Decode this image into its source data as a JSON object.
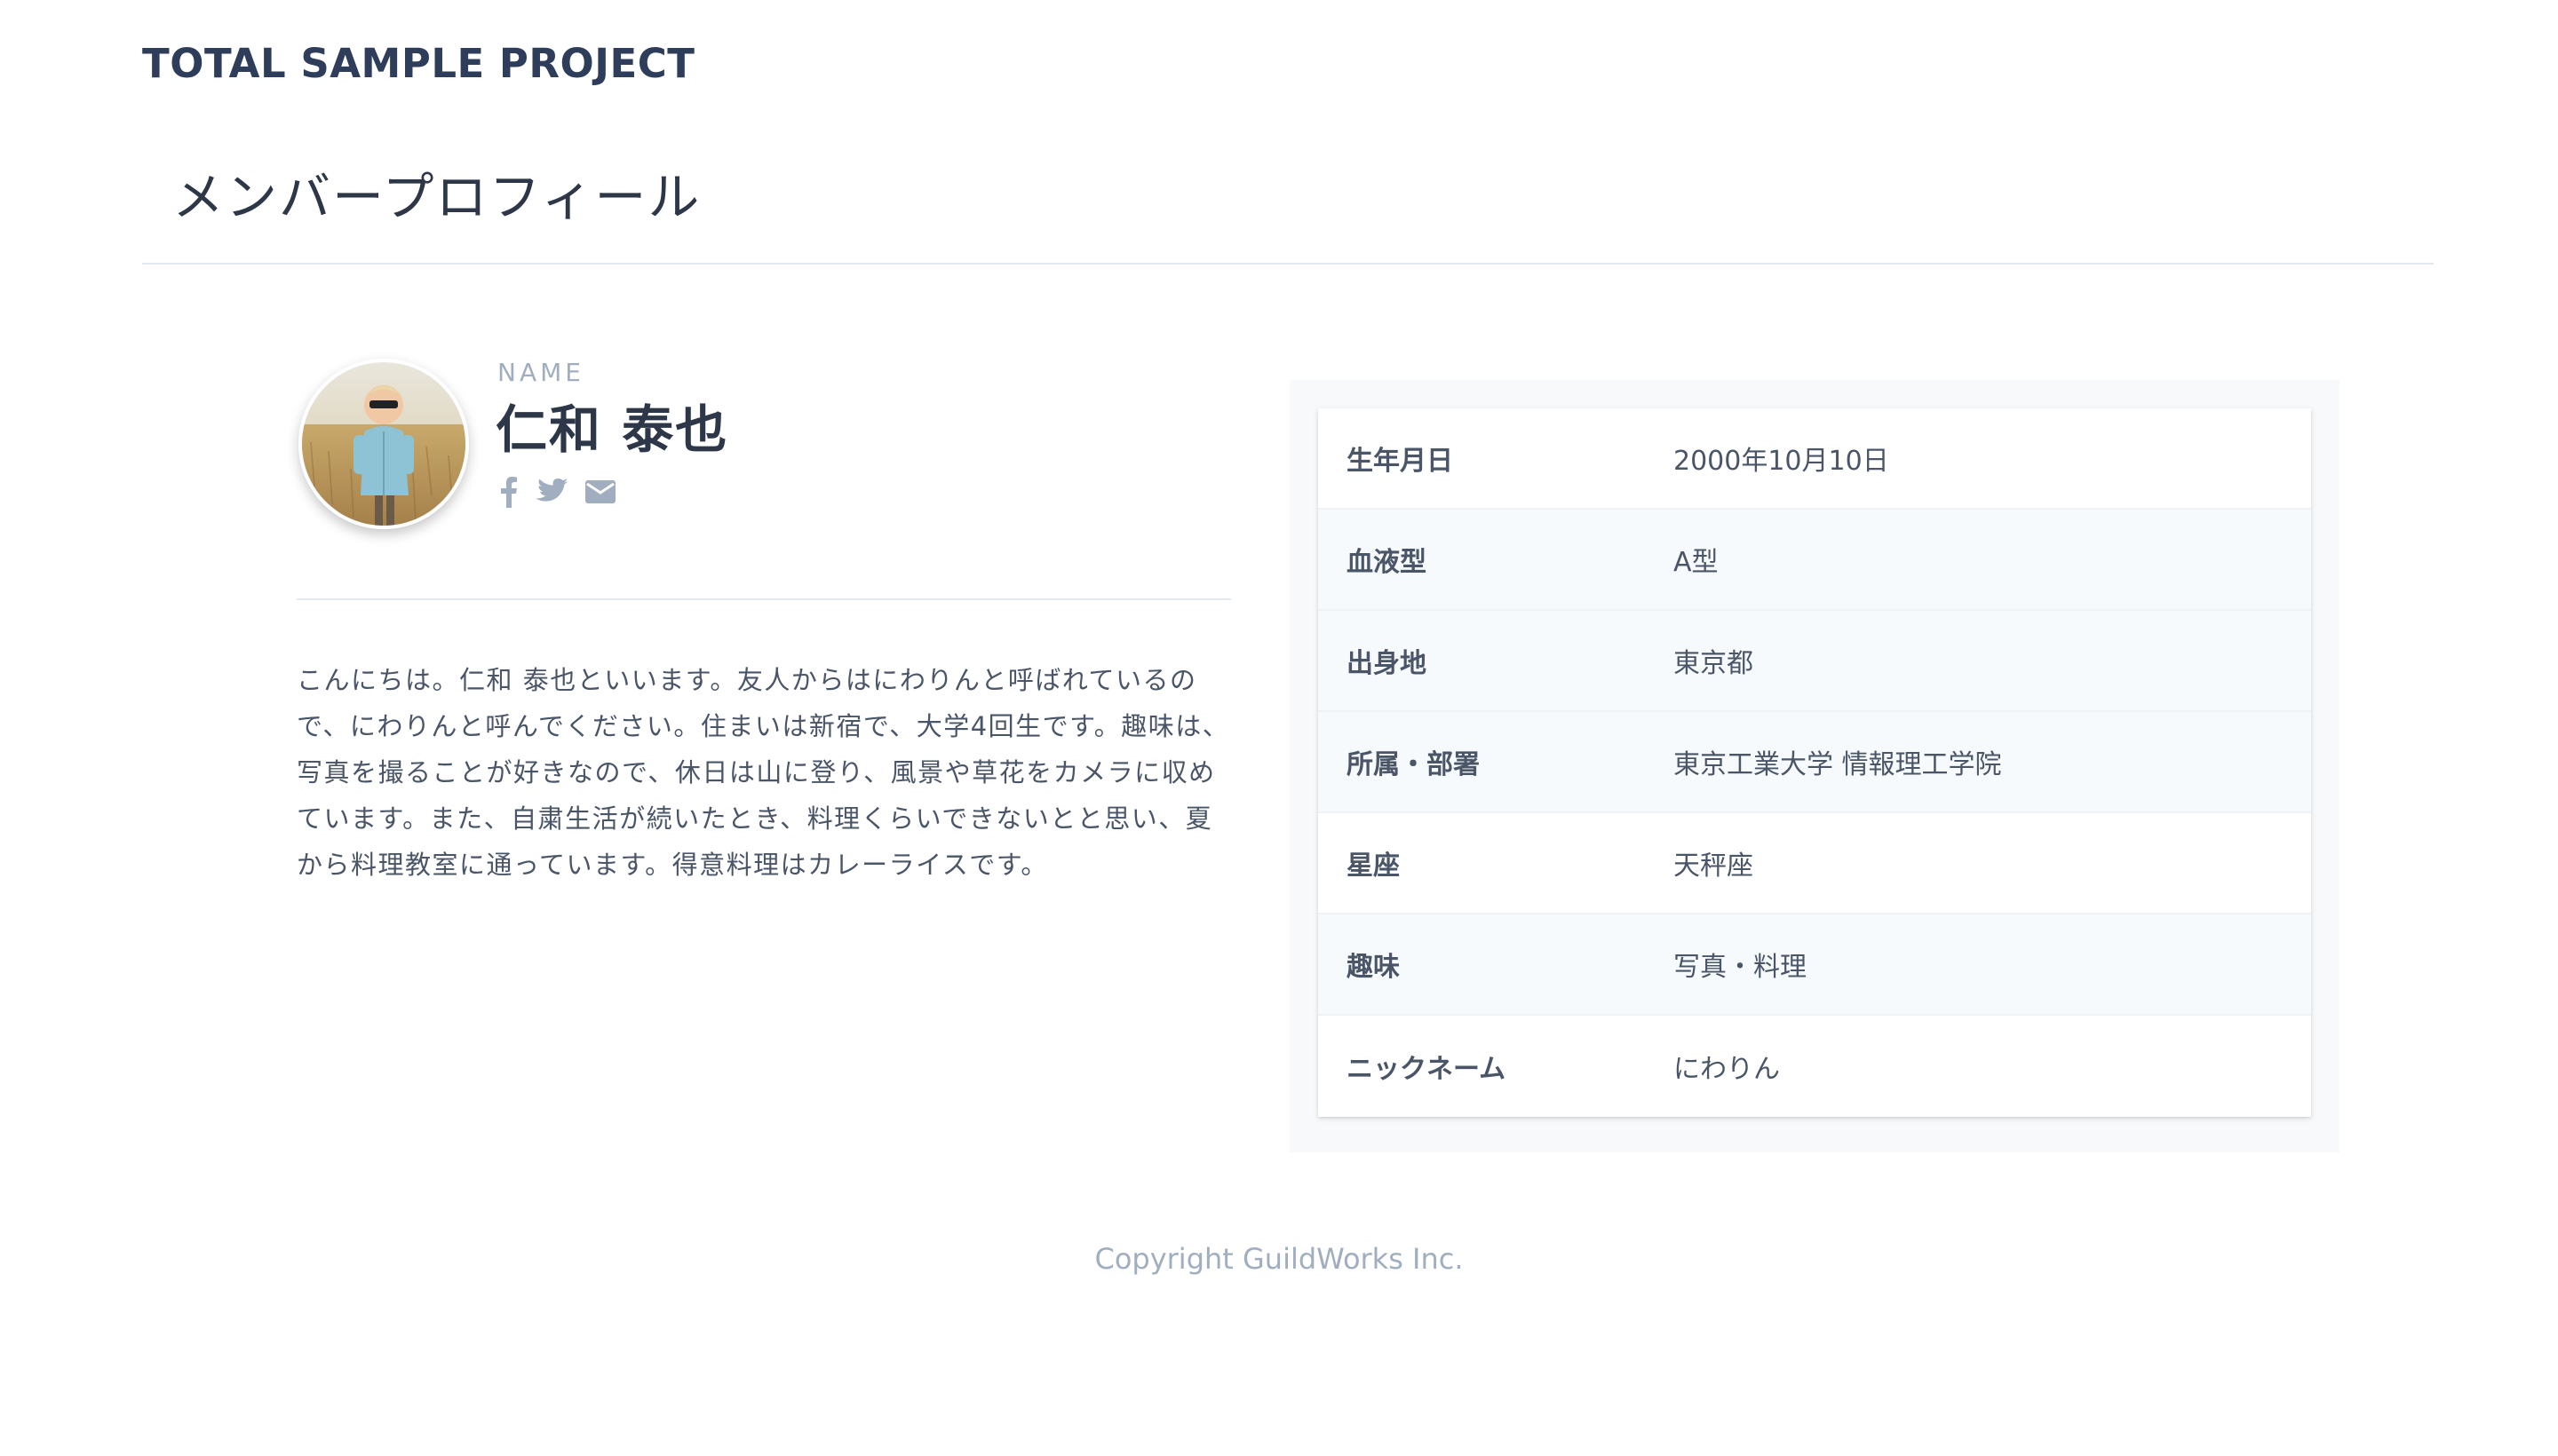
{
  "header": {
    "site_title": "TOTAL SAMPLE PROJECT"
  },
  "page": {
    "title": "メンバープロフィール"
  },
  "profile": {
    "name_caption": "NAME",
    "name": "仁和 泰也",
    "social_icons": [
      "facebook-icon",
      "twitter-icon",
      "mail-icon"
    ],
    "bio": "こんにちは。仁和 泰也といいます。友人からはにわりんと呼ばれているので、にわりんと呼んでください。住まいは新宿で、大学4回生です。趣味は、写真を撮ることが好きなので、休日は山に登り、風景や草花をカメラに収めています。また、自粛生活が続いたとき、料理くらいできないとと思い、夏から料理教室に通っています。得意料理はカレーライスです。"
  },
  "info": {
    "rows": [
      {
        "label": "生年月日",
        "value": "2000年10月10日"
      },
      {
        "label": "血液型",
        "value": "A型"
      },
      {
        "label": "出身地",
        "value": "東京都"
      },
      {
        "label": "所属・部署",
        "value": "東京工業大学 情報理工学院"
      },
      {
        "label": "星座",
        "value": "天秤座"
      },
      {
        "label": "趣味",
        "value": "写真・料理"
      },
      {
        "label": "ニックネーム",
        "value": "にわりん"
      }
    ]
  },
  "footer": {
    "copyright": "Copyright GuildWorks Inc."
  },
  "colors": {
    "heading": "#2d3d5a",
    "muted": "#a0aec0",
    "divider": "#e2e8f0",
    "panel_bg": "#f7f9fb"
  }
}
